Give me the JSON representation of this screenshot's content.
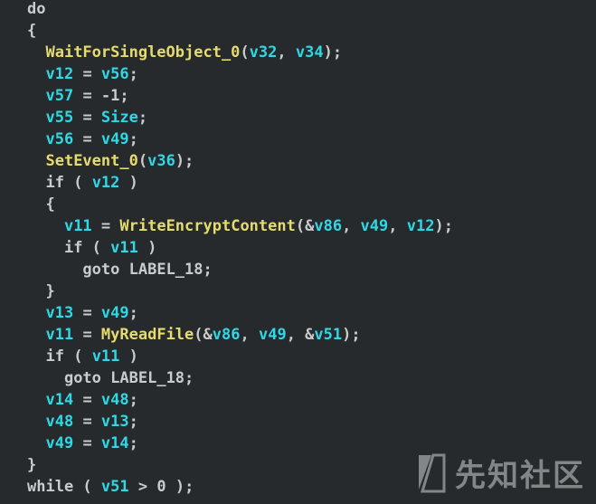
{
  "code": {
    "lines": [
      [
        {
          "t": "do",
          "c": "kw"
        }
      ],
      [
        {
          "t": "{",
          "c": "pun"
        }
      ],
      [
        {
          "t": "  "
        },
        {
          "t": "WaitForSingleObject_0",
          "c": "fn"
        },
        {
          "t": "(",
          "c": "pun"
        },
        {
          "t": "v32",
          "c": "var"
        },
        {
          "t": ", ",
          "c": "pun"
        },
        {
          "t": "v34",
          "c": "var"
        },
        {
          "t": ");",
          "c": "pun"
        }
      ],
      [
        {
          "t": "  "
        },
        {
          "t": "v12",
          "c": "var"
        },
        {
          "t": " = ",
          "c": "pun"
        },
        {
          "t": "v56",
          "c": "var"
        },
        {
          "t": ";",
          "c": "pun"
        }
      ],
      [
        {
          "t": "  "
        },
        {
          "t": "v57",
          "c": "var"
        },
        {
          "t": " = ",
          "c": "pun"
        },
        {
          "t": "-1",
          "c": "num"
        },
        {
          "t": ";",
          "c": "pun"
        }
      ],
      [
        {
          "t": "  "
        },
        {
          "t": "v55",
          "c": "var"
        },
        {
          "t": " = ",
          "c": "pun"
        },
        {
          "t": "Size",
          "c": "var"
        },
        {
          "t": ";",
          "c": "pun"
        }
      ],
      [
        {
          "t": "  "
        },
        {
          "t": "v56",
          "c": "var"
        },
        {
          "t": " = ",
          "c": "pun"
        },
        {
          "t": "v49",
          "c": "var"
        },
        {
          "t": ";",
          "c": "pun"
        }
      ],
      [
        {
          "t": "  "
        },
        {
          "t": "SetEvent_0",
          "c": "fn"
        },
        {
          "t": "(",
          "c": "pun"
        },
        {
          "t": "v36",
          "c": "var"
        },
        {
          "t": ");",
          "c": "pun"
        }
      ],
      [
        {
          "t": "  "
        },
        {
          "t": "if",
          "c": "kw"
        },
        {
          "t": " ( ",
          "c": "pun"
        },
        {
          "t": "v12",
          "c": "var"
        },
        {
          "t": " )",
          "c": "pun"
        }
      ],
      [
        {
          "t": "  "
        },
        {
          "t": "{",
          "c": "pun"
        }
      ],
      [
        {
          "t": "    "
        },
        {
          "t": "v11",
          "c": "var"
        },
        {
          "t": " = ",
          "c": "pun"
        },
        {
          "t": "WriteEncryptContent",
          "c": "fn"
        },
        {
          "t": "(&",
          "c": "pun"
        },
        {
          "t": "v86",
          "c": "var"
        },
        {
          "t": ", ",
          "c": "pun"
        },
        {
          "t": "v49",
          "c": "var"
        },
        {
          "t": ", ",
          "c": "pun"
        },
        {
          "t": "v12",
          "c": "var"
        },
        {
          "t": ");",
          "c": "pun"
        }
      ],
      [
        {
          "t": "    "
        },
        {
          "t": "if",
          "c": "kw"
        },
        {
          "t": " ( ",
          "c": "pun"
        },
        {
          "t": "v11",
          "c": "var"
        },
        {
          "t": " )",
          "c": "pun"
        }
      ],
      [
        {
          "t": "      "
        },
        {
          "t": "goto",
          "c": "kw"
        },
        {
          "t": " ",
          "c": "pun"
        },
        {
          "t": "LABEL_18",
          "c": "lbl"
        },
        {
          "t": ";",
          "c": "pun"
        }
      ],
      [
        {
          "t": "  "
        },
        {
          "t": "}",
          "c": "pun"
        }
      ],
      [
        {
          "t": "  "
        },
        {
          "t": "v13",
          "c": "var"
        },
        {
          "t": " = ",
          "c": "pun"
        },
        {
          "t": "v49",
          "c": "var"
        },
        {
          "t": ";",
          "c": "pun"
        }
      ],
      [
        {
          "t": "  "
        },
        {
          "t": "v11",
          "c": "var"
        },
        {
          "t": " = ",
          "c": "pun"
        },
        {
          "t": "MyReadFile",
          "c": "fn"
        },
        {
          "t": "(&",
          "c": "pun"
        },
        {
          "t": "v86",
          "c": "var"
        },
        {
          "t": ", ",
          "c": "pun"
        },
        {
          "t": "v49",
          "c": "var"
        },
        {
          "t": ", &",
          "c": "pun"
        },
        {
          "t": "v51",
          "c": "var"
        },
        {
          "t": ");",
          "c": "pun"
        }
      ],
      [
        {
          "t": "  "
        },
        {
          "t": "if",
          "c": "kw"
        },
        {
          "t": " ( ",
          "c": "pun"
        },
        {
          "t": "v11",
          "c": "var"
        },
        {
          "t": " )",
          "c": "pun"
        }
      ],
      [
        {
          "t": "    "
        },
        {
          "t": "goto",
          "c": "kw"
        },
        {
          "t": " ",
          "c": "pun"
        },
        {
          "t": "LABEL_18",
          "c": "lbl"
        },
        {
          "t": ";",
          "c": "pun"
        }
      ],
      [
        {
          "t": "  "
        },
        {
          "t": "v14",
          "c": "var"
        },
        {
          "t": " = ",
          "c": "pun"
        },
        {
          "t": "v48",
          "c": "var"
        },
        {
          "t": ";",
          "c": "pun"
        }
      ],
      [
        {
          "t": "  "
        },
        {
          "t": "v48",
          "c": "var"
        },
        {
          "t": " = ",
          "c": "pun"
        },
        {
          "t": "v13",
          "c": "var"
        },
        {
          "t": ";",
          "c": "pun"
        }
      ],
      [
        {
          "t": "  "
        },
        {
          "t": "v49",
          "c": "var"
        },
        {
          "t": " = ",
          "c": "pun"
        },
        {
          "t": "v14",
          "c": "var"
        },
        {
          "t": ";",
          "c": "pun"
        }
      ],
      [
        {
          "t": "}",
          "c": "pun"
        }
      ],
      [
        {
          "t": "while",
          "c": "kw"
        },
        {
          "t": " ( ",
          "c": "pun"
        },
        {
          "t": "v51",
          "c": "var"
        },
        {
          "t": " > ",
          "c": "pun"
        },
        {
          "t": "0",
          "c": "num"
        },
        {
          "t": " );",
          "c": "pun"
        }
      ]
    ]
  },
  "colors": {
    "background": "#272a2c",
    "identifier": "#2fd8e6",
    "function": "#e6dc6e",
    "text": "#c9cccc"
  },
  "watermark": {
    "text": "先知社区",
    "icon": "xianzhi-logo-icon"
  }
}
